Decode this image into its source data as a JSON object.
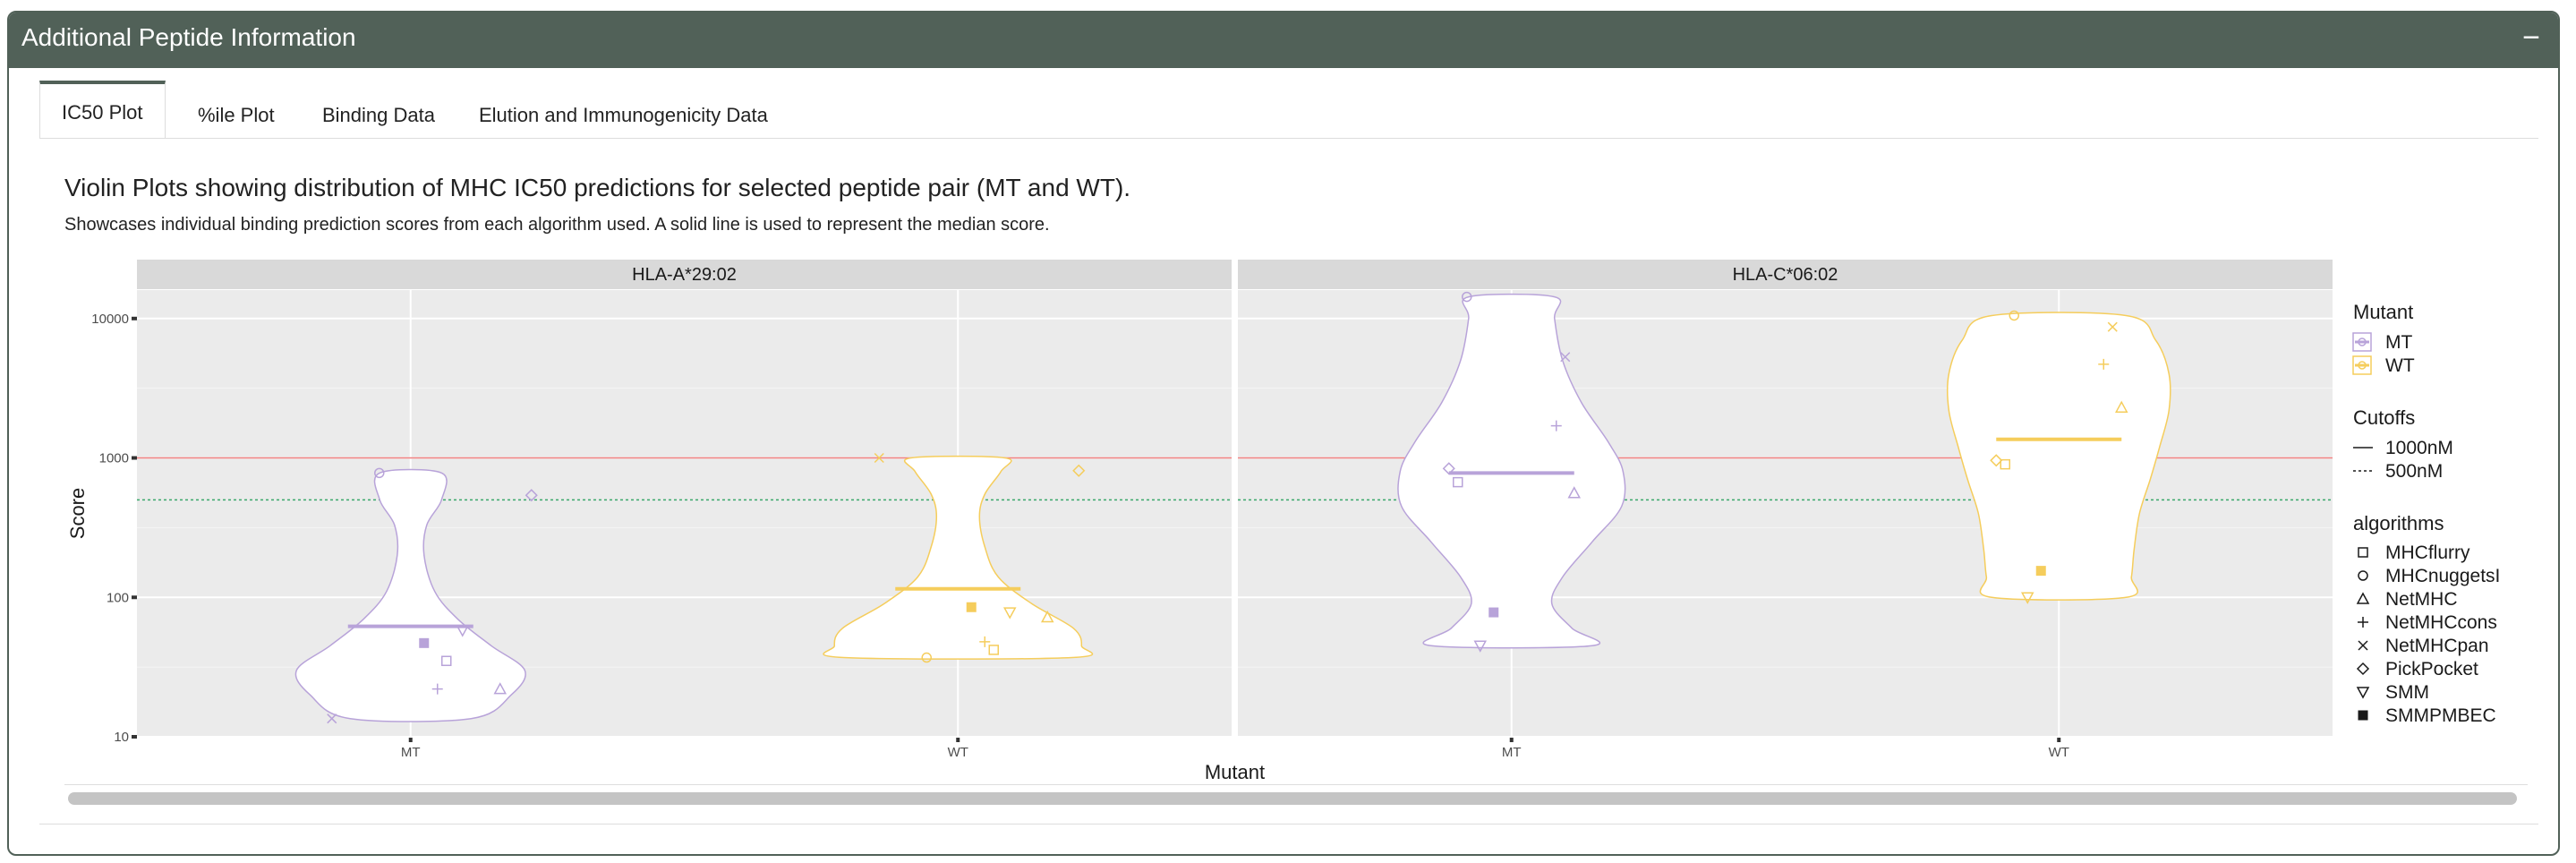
{
  "box": {
    "title": "Additional Peptide Information",
    "collapse_label": "−"
  },
  "tabs": [
    "IC50 Plot",
    "%ile Plot",
    "Binding Data",
    "Elution and Immunogenicity Data"
  ],
  "active_tab": "IC50 Plot",
  "plot": {
    "title": "Violin Plots showing distribution of MHC IC50 predictions for selected peptide pair (MT and WT).",
    "subtitle": "Showcases individual binding prediction scores from each algorithm used. A solid line is used to represent the median score."
  },
  "chart_data": {
    "type": "violin",
    "xlabel": "Mutant",
    "ylabel": "Score",
    "y_scale": "log10",
    "ylim": [
      10,
      16000
    ],
    "y_ticks": [
      10,
      100,
      1000,
      10000
    ],
    "y_tick_labels": [
      "10",
      "100",
      "1000",
      "10000"
    ],
    "categories": [
      "MT",
      "WT"
    ],
    "grid": true,
    "legend_position": "right",
    "background": "#ebebeb",
    "colors": {
      "MT": "#b8a3d9",
      "WT": "#f5cd5c",
      "cutoff_1000": "#f08080",
      "cutoff_500": "#3aa86b"
    },
    "cutoffs": [
      {
        "name": "1000nM",
        "value": 1000,
        "linetype": "solid"
      },
      {
        "name": "500nM",
        "value": 500,
        "linetype": "dotted"
      }
    ],
    "panels": [
      {
        "allele": "HLA-A*29:02",
        "groups": [
          {
            "category": "MT",
            "median": 62,
            "points": [
              {
                "algorithm": "MHCflurry",
                "value": 35
              },
              {
                "algorithm": "MHCnuggetsI",
                "value": 780
              },
              {
                "algorithm": "NetMHC",
                "value": 22
              },
              {
                "algorithm": "NetMHCcons",
                "value": 22
              },
              {
                "algorithm": "NetMHCpan",
                "value": 13.5
              },
              {
                "algorithm": "PickPocket",
                "value": 540
              },
              {
                "algorithm": "SMM",
                "value": 58
              },
              {
                "algorithm": "SMMPMBEC",
                "value": 47
              }
            ]
          },
          {
            "category": "WT",
            "median": 115,
            "points": [
              {
                "algorithm": "MHCflurry",
                "value": 42
              },
              {
                "algorithm": "MHCnuggetsI",
                "value": 37
              },
              {
                "algorithm": "NetMHC",
                "value": 72
              },
              {
                "algorithm": "NetMHCcons",
                "value": 48
              },
              {
                "algorithm": "NetMHCpan",
                "value": 1000
              },
              {
                "algorithm": "PickPocket",
                "value": 810
              },
              {
                "algorithm": "SMM",
                "value": 78
              },
              {
                "algorithm": "SMMPMBEC",
                "value": 85
              }
            ]
          }
        ]
      },
      {
        "allele": "HLA-C*06:02",
        "groups": [
          {
            "category": "MT",
            "median": 780,
            "points": [
              {
                "algorithm": "MHCflurry",
                "value": 670
              },
              {
                "algorithm": "MHCnuggetsI",
                "value": 14300
              },
              {
                "algorithm": "NetMHC",
                "value": 560
              },
              {
                "algorithm": "NetMHCcons",
                "value": 1700
              },
              {
                "algorithm": "NetMHCpan",
                "value": 5300
              },
              {
                "algorithm": "PickPocket",
                "value": 840
              },
              {
                "algorithm": "SMM",
                "value": 45
              },
              {
                "algorithm": "SMMPMBEC",
                "value": 78
              }
            ]
          },
          {
            "category": "WT",
            "median": 1360,
            "points": [
              {
                "algorithm": "MHCflurry",
                "value": 900
              },
              {
                "algorithm": "MHCnuggetsI",
                "value": 10500
              },
              {
                "algorithm": "NetMHC",
                "value": 2300
              },
              {
                "algorithm": "NetMHCcons",
                "value": 4700
              },
              {
                "algorithm": "NetMHCpan",
                "value": 8700
              },
              {
                "algorithm": "PickPocket",
                "value": 960
              },
              {
                "algorithm": "SMM",
                "value": 100
              },
              {
                "algorithm": "SMMPMBEC",
                "value": 155
              }
            ]
          }
        ]
      }
    ],
    "legend": {
      "mutant_title": "Mutant",
      "mutant_items": [
        "MT",
        "WT"
      ],
      "cutoffs_title": "Cutoffs",
      "cutoff_items": [
        "1000nM",
        "500nM"
      ],
      "algorithms_title": "algorithms",
      "algorithm_items": [
        {
          "name": "MHCflurry",
          "shape": "square-open"
        },
        {
          "name": "MHCnuggetsI",
          "shape": "circle-open"
        },
        {
          "name": "NetMHC",
          "shape": "triangle-open"
        },
        {
          "name": "NetMHCcons",
          "shape": "plus"
        },
        {
          "name": "NetMHCpan",
          "shape": "cross"
        },
        {
          "name": "PickPocket",
          "shape": "diamond-open"
        },
        {
          "name": "SMM",
          "shape": "triangle-down-open"
        },
        {
          "name": "SMMPMBEC",
          "shape": "square-filled"
        }
      ]
    }
  }
}
